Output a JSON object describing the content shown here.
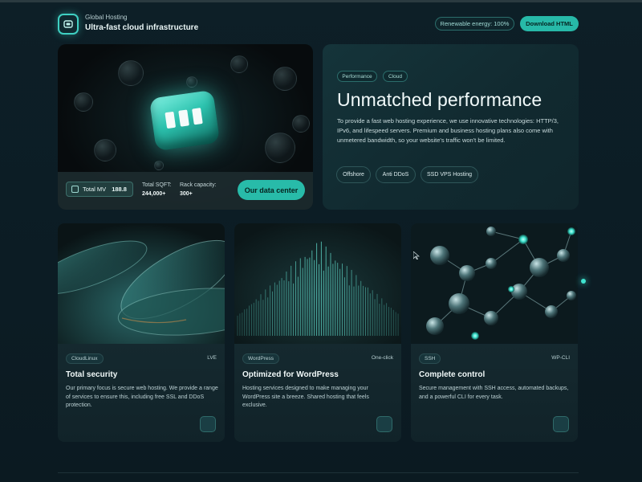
{
  "header": {
    "brand_subtitle": "Global Hosting",
    "brand_title": "Ultra-fast cloud infrastructure",
    "energy_badge": "Renewable energy: 100%",
    "download_button": "Download HTML"
  },
  "hero": {
    "stats": {
      "total_mv_label": "Total MV",
      "total_mv_value": "188.8",
      "sqft_label": "Total SQFT:",
      "sqft_value": "244,000+",
      "rack_label": "Rack capacity:",
      "rack_value": "300+"
    },
    "cta_button": "Our data center"
  },
  "performance": {
    "tags": [
      "Performance",
      "Cloud"
    ],
    "title": "Unmatched performance",
    "text": "To provide a fast web hosting experience, we use innovative technologies: HTTP/3, IPv6, and lifespeed servers. Premium and business hosting plans also come with unmetered bandwidth, so your website's traffic won't be limited.",
    "chips": [
      "Offshore",
      "Anti DDoS",
      "SSD VPS Hosting"
    ]
  },
  "features": [
    {
      "tag": "CloudLinux",
      "right": "LVE",
      "title": "Total security",
      "text": "Our primary focus is secure web hosting. We provide a range of services to ensure this, including free SSL and DDoS protection."
    },
    {
      "tag": "WordPress",
      "right": "One-click",
      "title": "Optimized for WordPress",
      "text": "Hosting services designed to make managing your WordPress site a breeze. Shared hosting that feels exclusive."
    },
    {
      "tag": "SSH",
      "right": "WP-CLI",
      "title": "Complete control",
      "text": "Secure management with SSH access, automated backups, and a powerful CLI for every task."
    }
  ],
  "colors": {
    "accent": "#28bba9",
    "background": "#0d1f27",
    "card": "#12262c"
  }
}
